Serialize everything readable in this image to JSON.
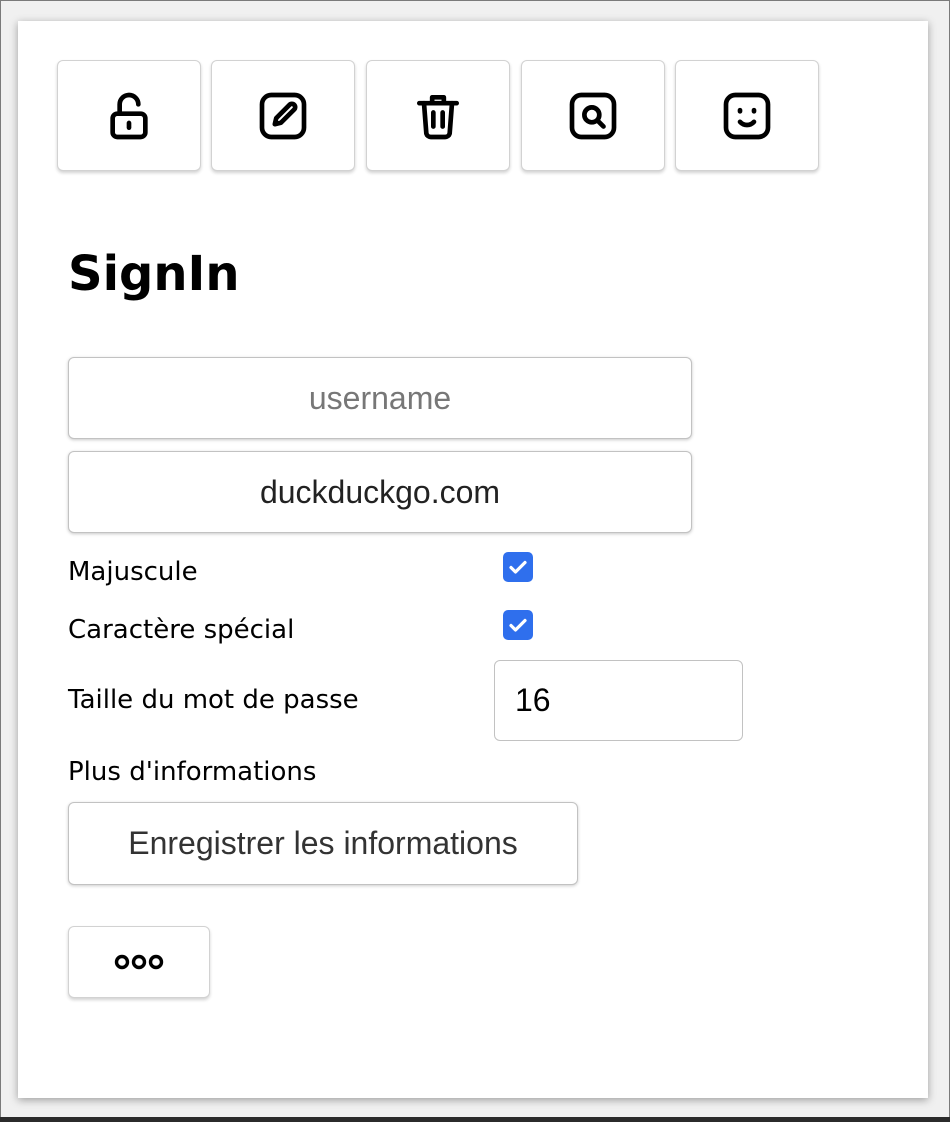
{
  "toolbar": {
    "buttons": [
      {
        "icon": "unlock-icon"
      },
      {
        "icon": "edit-icon"
      },
      {
        "icon": "trash-icon"
      },
      {
        "icon": "search-icon"
      },
      {
        "icon": "smiley-icon"
      }
    ]
  },
  "form": {
    "title": "SignIn",
    "username": {
      "placeholder": "username",
      "value": ""
    },
    "site": {
      "value": "duckduckgo.com"
    },
    "uppercase": {
      "label": "Majuscule",
      "checked": true
    },
    "special_char": {
      "label": "Caractère spécial",
      "checked": true
    },
    "length": {
      "label": "Taille du mot de passe",
      "value": "16"
    },
    "more_info_label": "Plus d'informations",
    "save_label": "Enregistrer les informations",
    "more_icon": "more-dots-icon"
  },
  "colors": {
    "checkbox_accent": "#2f6fed",
    "panel_background": "#ffffff"
  }
}
